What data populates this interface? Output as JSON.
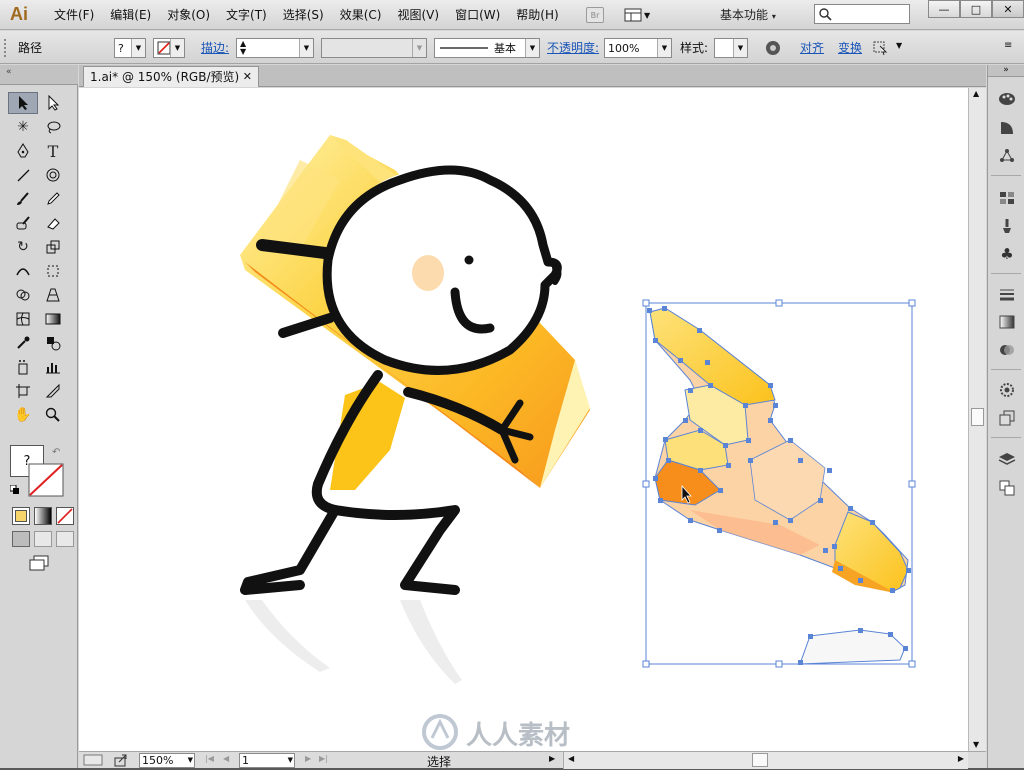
{
  "app": {
    "logo": "Ai",
    "menu": [
      "文件(F)",
      "编辑(E)",
      "对象(O)",
      "文字(T)",
      "选择(S)",
      "效果(C)",
      "视图(V)",
      "窗口(W)",
      "帮助(H)"
    ],
    "bridge_label": "Br",
    "workspace_label": "基本功能",
    "search_placeholder": "",
    "window_controls": [
      "—",
      "□",
      "✕"
    ]
  },
  "control_bar": {
    "selection_label": "路径",
    "fill_value": "?",
    "stroke_link": "描边:",
    "stroke_style_label": "基本",
    "opacity_link": "不透明度:",
    "opacity_value": "100%",
    "style_label": "样式:",
    "align_link": "对齐",
    "transform_link": "变换"
  },
  "document": {
    "tab_title": "1.ai* @ 150% (RGB/预览)",
    "tab_close": "✕"
  },
  "tools": {
    "fill_stroke_unknown": "?"
  },
  "status_bar": {
    "zoom": "150%",
    "artboard": "1",
    "tool_name": "选择"
  },
  "watermark": {
    "text": "人人素材"
  },
  "colors": {
    "accent_link": "#1a55b8",
    "selection_blue": "#5a84d6",
    "pencil_yellow": "#fcc419",
    "pencil_orange": "#f89a1c",
    "skin": "#fcd3a5"
  }
}
